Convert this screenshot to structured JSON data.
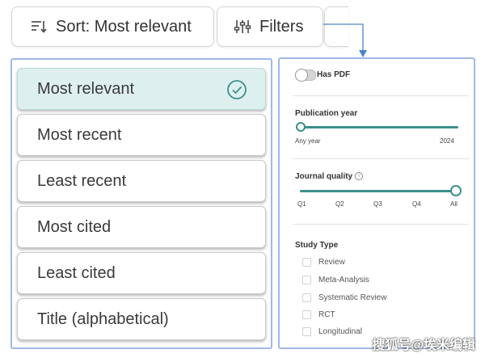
{
  "toolbar": {
    "sort_label": "Sort: Most relevant",
    "filters_label": "Filters"
  },
  "sort_options": [
    {
      "label": "Most relevant",
      "selected": true
    },
    {
      "label": "Most recent",
      "selected": false
    },
    {
      "label": "Least recent",
      "selected": false
    },
    {
      "label": "Most cited",
      "selected": false
    },
    {
      "label": "Least cited",
      "selected": false
    },
    {
      "label": "Title (alphabetical)",
      "selected": false
    }
  ],
  "filters": {
    "has_pdf": {
      "label": "Has PDF",
      "enabled": false
    },
    "publication_year": {
      "label": "Publication year",
      "min_label": "Any year",
      "max_label": "2024"
    },
    "journal_quality": {
      "label": "Journal quality",
      "ticks": [
        "Q1",
        "Q2",
        "Q3",
        "Q4",
        "All"
      ],
      "selected": "All"
    },
    "study_type": {
      "label": "Study Type",
      "options": [
        "Review",
        "Meta-Analysis",
        "Systematic Review",
        "RCT",
        "Longitudinal"
      ]
    }
  },
  "colors": {
    "accent": "#3c8f8b",
    "panel_border": "#9fb8e6",
    "selected_bg": "#ddf0ef",
    "connector": "#4a86c8"
  },
  "watermark": "搜狐号@埃米编辑"
}
